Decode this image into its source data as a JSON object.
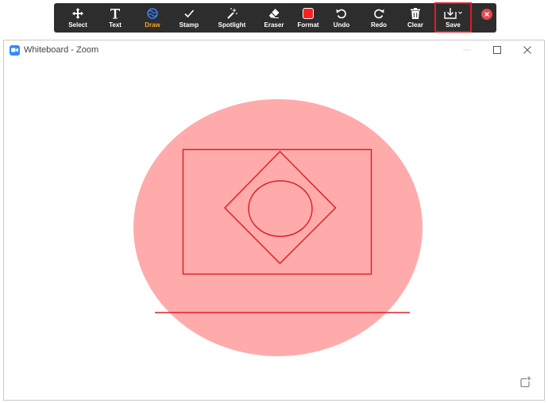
{
  "toolbar": {
    "tools": [
      {
        "id": "select",
        "label": "Select",
        "icon": "move-arrows-icon"
      },
      {
        "id": "text",
        "label": "Text",
        "icon": "text-t-icon"
      },
      {
        "id": "draw",
        "label": "Draw",
        "icon": "draw-squiggle-icon",
        "active": true
      },
      {
        "id": "stamp",
        "label": "Stamp",
        "icon": "checkmark-icon"
      },
      {
        "id": "spotlight",
        "label": "Spotlight",
        "icon": "magic-wand-icon"
      },
      {
        "id": "eraser",
        "label": "Eraser",
        "icon": "eraser-icon"
      },
      {
        "id": "format",
        "label": "Format",
        "icon": "color-swatch-icon"
      },
      {
        "id": "undo",
        "label": "Undo",
        "icon": "undo-arrow-icon"
      },
      {
        "id": "redo",
        "label": "Redo",
        "icon": "redo-arrow-icon"
      },
      {
        "id": "clear",
        "label": "Clear",
        "icon": "trash-icon"
      },
      {
        "id": "save",
        "label": "Save",
        "icon": "download-icon",
        "highlighted": true
      }
    ],
    "active_color": "#f5a623",
    "format_color": "#ff2020",
    "highlight_color": "#e01b22"
  },
  "window": {
    "title": "Whiteboard - Zoom",
    "app_color": "#2d8cff"
  },
  "drawing": {
    "fill_color": "#ffabab",
    "stroke_color": "#e0202a"
  }
}
